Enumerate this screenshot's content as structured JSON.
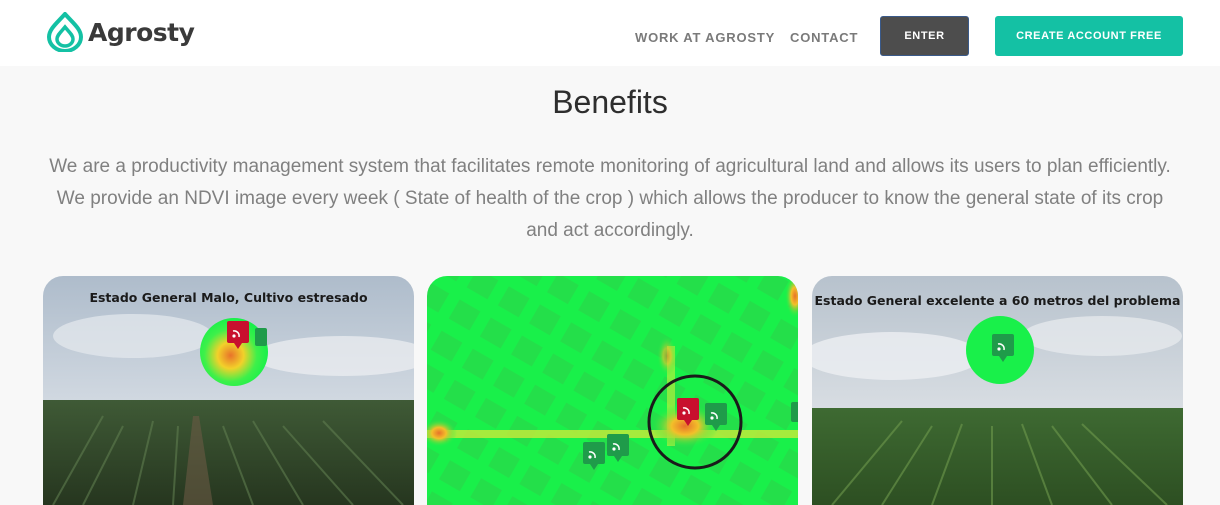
{
  "header": {
    "brand": "Agrosty",
    "nav": {
      "work": "WORK AT AGROSTY",
      "contact": "CONTACT",
      "enter": "ENTER",
      "create": "CREATE ACCOUNT FREE"
    }
  },
  "main": {
    "title": "Benefits",
    "description": "We are a productivity management system that facilitates remote monitoring of agricultural land and allows its users to plan efficiently. We provide an NDVI image every week ( State of health of the crop ) which allows the producer to know the general state of its crop and act accordingly."
  },
  "cards": {
    "left": {
      "caption": "Estado General Malo, Cultivo estresado"
    },
    "right": {
      "caption": "Estado General excelente a 60 metros del problema"
    }
  },
  "colors": {
    "accent": "#14c1a4",
    "enter_button": "#4d4d4d",
    "ndvi_green": "#19f04a",
    "alert_red": "#c8102e",
    "marker_green": "#1f9b4a"
  },
  "icons": [
    "logo-drop-icon",
    "rss-marker-icon"
  ]
}
